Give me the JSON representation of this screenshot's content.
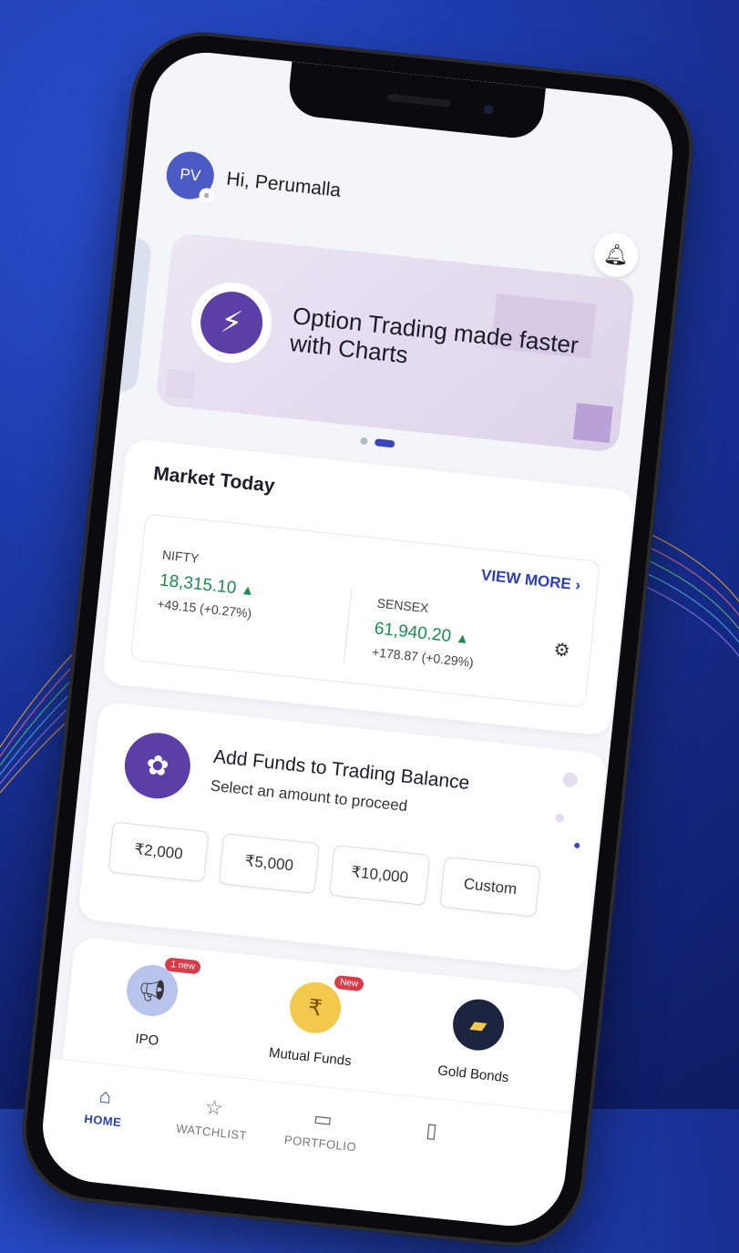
{
  "user": {
    "initials": "PV",
    "greeting": "Hi, Perumalla"
  },
  "banner": {
    "title": "Option Trading made faster with Charts",
    "slide_count": 2,
    "active_slide": 2
  },
  "market": {
    "title": "Market Today",
    "view_more": "VIEW MORE",
    "indices": [
      {
        "name": "NIFTY",
        "value": "18,315.10",
        "change": "+49.15 (+0.27%)",
        "direction": "up"
      },
      {
        "name": "SENSEX",
        "value": "61,940.20",
        "change": "+178.87 (+0.29%)",
        "direction": "up"
      }
    ]
  },
  "funds": {
    "title": "Add Funds to Trading Balance",
    "subtitle": "Select an amount to proceed",
    "amounts": [
      "₹2,000",
      "₹5,000",
      "₹10,000",
      "Custom"
    ]
  },
  "products": [
    {
      "label": "IPO",
      "badge": "1 new",
      "icon": "megaphone-icon"
    },
    {
      "label": "Mutual Funds",
      "badge": "New",
      "icon": "money-bag-icon"
    },
    {
      "label": "Gold Bonds",
      "badge": "",
      "icon": "gold-bars-icon"
    }
  ],
  "nav": [
    {
      "label": "HOME",
      "active": true
    },
    {
      "label": "WATCHLIST",
      "active": false
    },
    {
      "label": "PORTFOLIO",
      "active": false
    },
    {
      "label": "",
      "active": false
    }
  ],
  "colors": {
    "brand": "#2c3fb3",
    "accent_purple": "#5b3ea6",
    "positive": "#1d8a4e",
    "badge": "#d83b4a"
  }
}
